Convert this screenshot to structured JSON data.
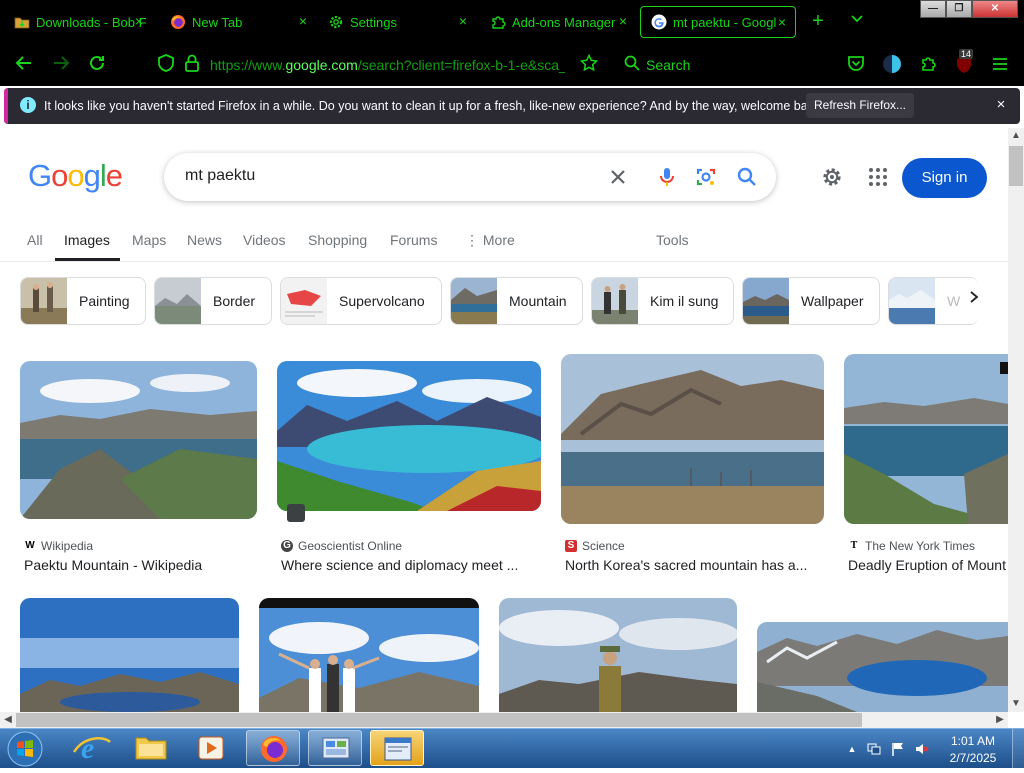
{
  "browser": {
    "tabs": [
      {
        "title": "Downloads - Bob F",
        "icon": "folder-download-icon"
      },
      {
        "title": "New Tab",
        "icon": "firefox-icon"
      },
      {
        "title": "Settings",
        "icon": "gear-icon"
      },
      {
        "title": "Add-ons Manager",
        "icon": "puzzle-icon"
      },
      {
        "title": "mt paektu - Googl",
        "icon": "google-g-icon",
        "active": true
      }
    ],
    "tab_close_glyph": "×",
    "new_tab_glyph": "+",
    "list_tabs_glyph": "⌄",
    "url_prefix": "https://www.",
    "url_domain": "google.com",
    "url_suffix": "/search?client=firefox-b-1-e&sca_",
    "search_placeholder": "Search",
    "downloads_badge": "14",
    "notification": {
      "text": "It looks like you haven't started Firefox in a while. Do you want to clean it up for a fresh, like-new experience? And by the way, welcome back!",
      "button": "Refresh Firefox...",
      "close": "×"
    }
  },
  "google": {
    "logo": [
      "G",
      "o",
      "o",
      "g",
      "l",
      "e"
    ],
    "logo_colors": [
      "#4285f4",
      "#ea4335",
      "#fbbc05",
      "#4285f4",
      "#34a853",
      "#ea4335"
    ],
    "query": "mt paektu",
    "sign_in": "Sign in",
    "tabs": [
      "All",
      "Images",
      "Maps",
      "News",
      "Videos",
      "Shopping",
      "Forums",
      "More",
      "Tools"
    ],
    "more_glyph": "⋮",
    "chips": [
      "Painting",
      "Border",
      "Supervolcano",
      "Mountain",
      "Kim il sung",
      "Wallpaper",
      "W"
    ],
    "results": [
      {
        "source": "Wikipedia",
        "title": "Paektu Mountain - Wikipedia",
        "icon_glyph": "W"
      },
      {
        "source": "Geoscientist Online",
        "title": "Where science and diplomacy meet ...",
        "icon_glyph": "G"
      },
      {
        "source": "Science",
        "title": "North Korea's sacred mountain has a...",
        "icon_glyph": "S"
      },
      {
        "source": "The New York Times",
        "title": "Deadly Eruption of Mount",
        "icon_glyph": "T"
      }
    ]
  },
  "taskbar": {
    "time": "1:01 AM",
    "date": "2/7/2025"
  }
}
